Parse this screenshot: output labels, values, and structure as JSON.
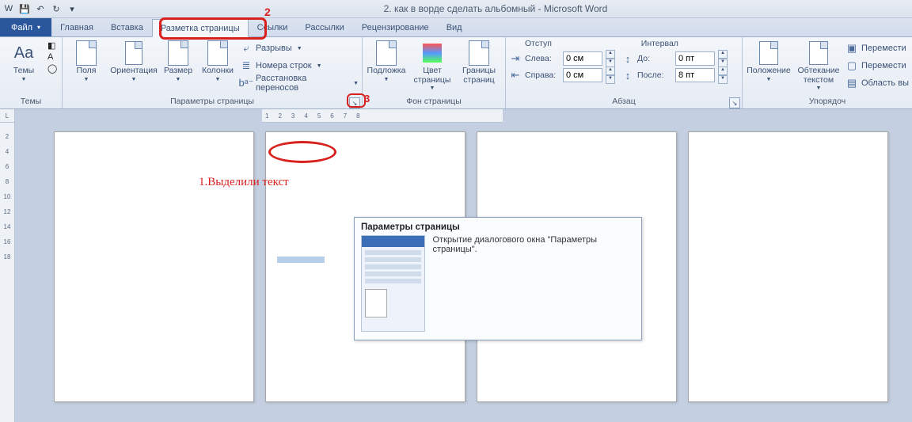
{
  "app": {
    "window_title": "2. как в ворде сделать альбомный  -  Microsoft Word"
  },
  "qat": {
    "word_icon": "W",
    "save": "💾",
    "undo": "↶",
    "redo": "↻",
    "customize": "▾"
  },
  "tabs": {
    "file": "Файл",
    "home": "Главная",
    "insert": "Вставка",
    "layout": "Разметка страницы",
    "refs": "Ссылки",
    "mail": "Рассылки",
    "review": "Рецензирование",
    "view": "Вид"
  },
  "ribbon": {
    "themes": {
      "label": "Темы",
      "group": "Темы"
    },
    "page_setup": {
      "margins": "Поля",
      "orientation": "Ориентация",
      "size": "Размер",
      "columns": "Колонки",
      "breaks": "Разрывы",
      "line_numbers": "Номера строк",
      "hyphenation": "Расстановка переносов",
      "group": "Параметры страницы"
    },
    "page_bg": {
      "watermark": "Подложка",
      "page_color": "Цвет страницы",
      "borders": "Границы страниц",
      "group": "Фон страницы"
    },
    "paragraph": {
      "indent_head": "Отступ",
      "spacing_head": "Интервал",
      "left_lbl": "Слева:",
      "right_lbl": "Справа:",
      "before_lbl": "До:",
      "after_lbl": "После:",
      "left_val": "0 см",
      "right_val": "0 см",
      "before_val": "0 пт",
      "after_val": "8 пт",
      "group": "Абзац"
    },
    "arrange": {
      "position": "Положение",
      "wrap": "Обтекание текстом",
      "move1": "Перемести",
      "move2": "Перемести",
      "selection": "Область вы",
      "group": "Упорядоч"
    }
  },
  "ruler": {
    "corner": "L",
    "h": [
      "1",
      "2",
      "3",
      "4",
      "5",
      "6",
      "7",
      "8"
    ],
    "v": [
      "2",
      "4",
      "6",
      "8",
      "10",
      "12",
      "14",
      "16",
      "18"
    ]
  },
  "annotations": {
    "n2": "2",
    "n3": "3",
    "selected_text": "1.Выделили текст"
  },
  "tooltip": {
    "title": "Параметры страницы",
    "desc": "Открытие диалогового окна \"Параметры страницы\"."
  }
}
